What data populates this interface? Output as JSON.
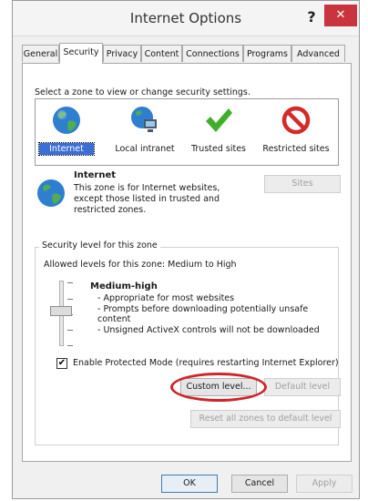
{
  "window": {
    "title": "Internet Options",
    "help_label": "?",
    "close_label": "✕"
  },
  "tabs": [
    {
      "label": "General"
    },
    {
      "label": "Security",
      "active": true
    },
    {
      "label": "Privacy"
    },
    {
      "label": "Content"
    },
    {
      "label": "Connections"
    },
    {
      "label": "Programs"
    },
    {
      "label": "Advanced"
    }
  ],
  "zones": {
    "instruction": "Select a zone to view or change security settings.",
    "items": [
      {
        "label": "Internet",
        "icon": "globe-icon",
        "selected": true
      },
      {
        "label": "Local intranet",
        "icon": "local-intranet-icon"
      },
      {
        "label": "Trusted sites",
        "icon": "checkmark-icon"
      },
      {
        "label": "Restricted sites",
        "icon": "prohibited-icon"
      }
    ]
  },
  "zone_info": {
    "title": "Internet",
    "description": "This zone is for Internet websites, except those listed in trusted and restricted zones.",
    "sites_button": "Sites"
  },
  "security_level": {
    "group_title": "Security level for this zone",
    "allowed_levels": "Allowed levels for this zone: Medium to High",
    "level_name": "Medium-high",
    "bullets": [
      "- Appropriate for most websites",
      "- Prompts before downloading potentially unsafe content",
      "- Unsigned ActiveX controls will not be downloaded"
    ],
    "protected_mode_label": "Enable Protected Mode (requires restarting Internet Explorer)",
    "protected_mode_checked": true,
    "custom_level_button": "Custom level...",
    "default_level_button": "Default level",
    "reset_all_button": "Reset all zones to default level"
  },
  "footer": {
    "ok": "OK",
    "cancel": "Cancel",
    "apply": "Apply"
  },
  "colors": {
    "close": "#c9343f",
    "highlight": "#d0242a",
    "selected_zone": "#3b6ed6"
  }
}
